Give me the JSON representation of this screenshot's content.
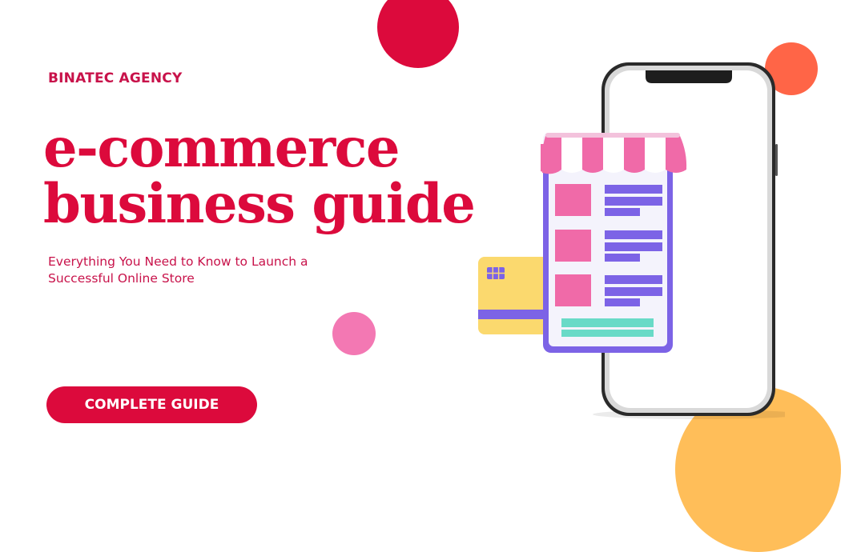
{
  "brand": {
    "name": "BINATEC AGENCY"
  },
  "headline": {
    "line1": "e-commerce",
    "line2": "business guide"
  },
  "subtitle": "Everything You Need to Know to Launch a Successful Online Store",
  "cta": {
    "label": "COMPLETE GUIDE"
  },
  "colors": {
    "brand_red": "#dc0a3c",
    "coral": "#ff6547",
    "pink": "#f378b3",
    "yellow": "#ffbe59",
    "purple": "#7c63e6",
    "teal": "#69dac7",
    "card_yellow": "#fbd96e"
  },
  "illustration": {
    "name": "smartphone-shop-illustration",
    "elements": [
      "smartphone",
      "shop-awning",
      "product-list",
      "credit-card"
    ]
  }
}
